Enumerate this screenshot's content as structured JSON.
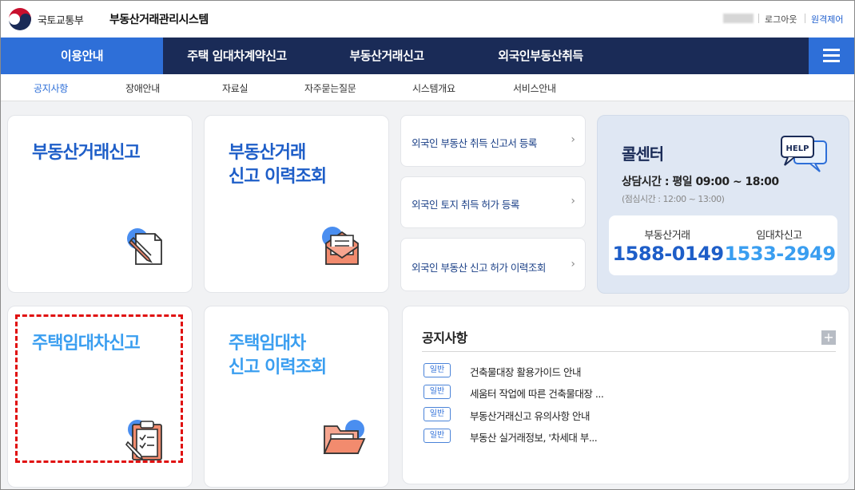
{
  "header": {
    "ministry": "국토교통부",
    "system_name": "부동산거래관리시스템",
    "logout_label": "로그아웃",
    "remote_label": "원격제어"
  },
  "gnb": {
    "items": [
      "이용안내",
      "주택 임대차계약신고",
      "부동산거래신고",
      "외국인부동산취득"
    ],
    "active_index": 0
  },
  "submenu": {
    "items": [
      "공지사항",
      "장애안내",
      "자료실",
      "자주묻는질문",
      "시스템개요",
      "서비스안내"
    ],
    "active_index": 0
  },
  "cards": {
    "real_estate_report": "부동산거래신고",
    "real_estate_history_line1": "부동산거래",
    "real_estate_history_line2": "신고 이력조회",
    "housing_lease_report": "주택임대차신고",
    "housing_lease_history_line1": "주택임대차",
    "housing_lease_history_line2": "신고 이력조회"
  },
  "foreign_links": [
    "외국인 부동산 취득 신고서 등록",
    "외국인 토지 취득 허가 등록",
    "외국인 부동산 신고 허가 이력조회"
  ],
  "callcenter": {
    "title": "콜센터",
    "help_badge": "HELP",
    "hours": "상담시간 : 평일 09:00 ~ 18:00",
    "lunch": "(점심시간 : 12:00 ~ 13:00)",
    "label_1": "부동산거래",
    "number_1": "1588-0149",
    "label_2": "임대차신고",
    "number_2": "1533-2949"
  },
  "notice": {
    "title": "공지사항",
    "more": "+",
    "items": [
      {
        "badge": "일반",
        "text": "건축물대장 활용가이드 안내"
      },
      {
        "badge": "일반",
        "text": "세움터 작업에 따른 건축물대장 ..."
      },
      {
        "badge": "일반",
        "text": "부동산거래신고 유의사항 안내"
      },
      {
        "badge": "일반",
        "text": "부동산 실거래정보, '차세대 부..."
      }
    ]
  },
  "colors": {
    "gnb_bg": "#1a2b57",
    "accent": "#2e6fd8",
    "title_blue": "#1e5ec8",
    "title_light_blue": "#3a9ef0",
    "highlight_red": "#e01010"
  }
}
